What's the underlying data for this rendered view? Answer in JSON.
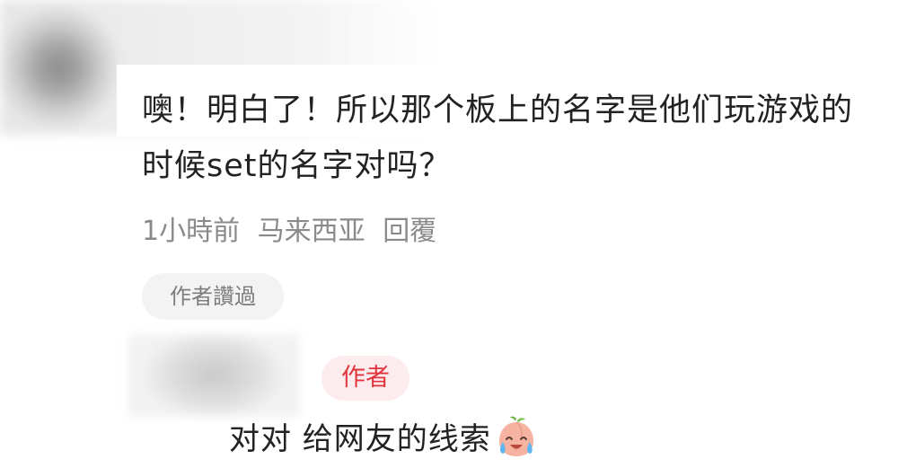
{
  "comment": {
    "text": "噢！明白了！所以那个板上的名字是他们玩游戏的时候set的名字对吗？",
    "time": "1小時前",
    "location": "马来西亚",
    "reply_label": "回覆",
    "liked_badge": "作者讚過"
  },
  "reply": {
    "author_badge": "作者",
    "text": "对对 给网友的线索",
    "emoji": "crying-laughing-peach-icon"
  },
  "colors": {
    "text_primary": "#222222",
    "text_secondary": "#8a8a8a",
    "author_badge_bg": "#fdecee",
    "author_badge_text": "#e0343f",
    "liked_badge_bg": "#f3f3f3"
  }
}
